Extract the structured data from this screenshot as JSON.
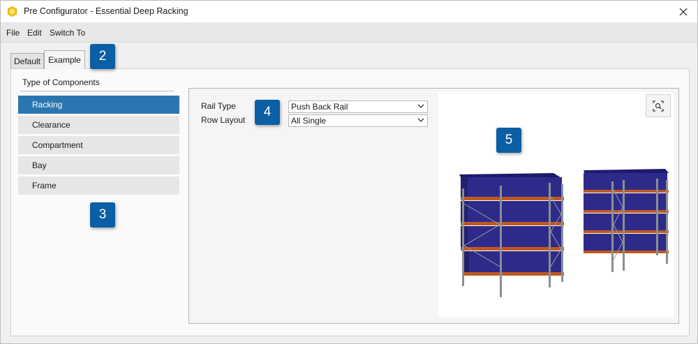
{
  "window": {
    "title": "Pre Configurator - Essential Deep Racking"
  },
  "menu": {
    "file": "File",
    "edit": "Edit",
    "switch_to": "Switch To"
  },
  "tabs": [
    {
      "label": "Default"
    },
    {
      "label": "Example"
    }
  ],
  "components": {
    "title": "Type of Components",
    "items": [
      {
        "label": "Racking"
      },
      {
        "label": "Clearance"
      },
      {
        "label": "Compartment"
      },
      {
        "label": "Bay"
      },
      {
        "label": "Frame"
      }
    ],
    "selected": "Racking"
  },
  "form": {
    "rail_type": {
      "label": "Rail Type",
      "value": "Push Back Rail"
    },
    "row_layout": {
      "label": "Row Layout",
      "value": "All Single"
    }
  },
  "callouts": {
    "c2": "2",
    "c3": "3",
    "c4": "4",
    "c5": "5"
  },
  "colors": {
    "accent": "#0b5fa5",
    "selected": "#2a76b1",
    "pallet": "#2e2a8a",
    "beam": "#c0581f",
    "frame": "#8a8f94"
  },
  "icons": {
    "app": "app-logo-icon",
    "close": "close-icon",
    "chevron": "chevron-down-icon",
    "zoom": "zoom-fit-icon"
  }
}
